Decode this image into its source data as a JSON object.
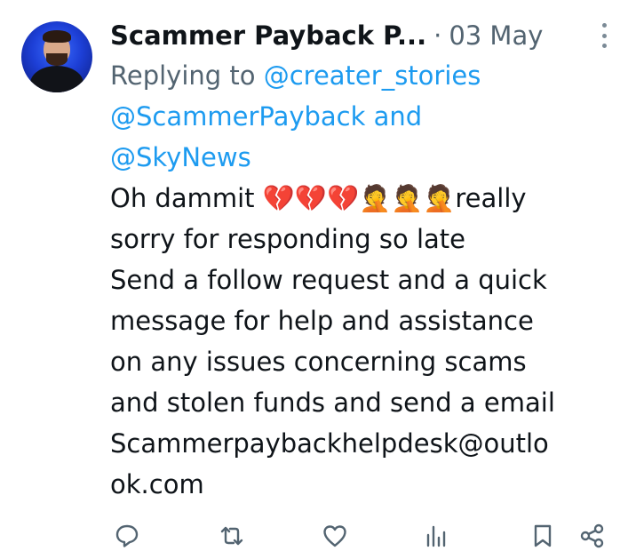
{
  "tweet": {
    "author_name": "Scammer Payback P...",
    "separator": "·",
    "date": "03 May",
    "replying_to_prefix": "Replying to",
    "mention_1": "@creater_stories",
    "mention_2": "@ScammerPayback",
    "and_word": "and",
    "mention_3": "@SkyNews",
    "body_line_1": "Oh dammit 💔💔💔🤦🤦🤦really",
    "body_line_2": "sorry for responding so late",
    "body_line_3": "Send a follow request and a quick",
    "body_line_4": "message for help and assistance",
    "body_line_5": "on any issues concerning scams",
    "body_line_6": "and stolen funds and send a email",
    "body_line_7": "Scammerpaybackhelpdesk@outlo",
    "body_line_8": "ok.com"
  },
  "actions": {
    "icons": [
      "reply-icon",
      "retweet-icon",
      "like-icon",
      "views-icon",
      "bookmark-icon",
      "share-icon"
    ]
  },
  "colors": {
    "text": "#0f1419",
    "secondary": "#536471",
    "mention": "#1d9bf0",
    "icon": "#536471"
  }
}
